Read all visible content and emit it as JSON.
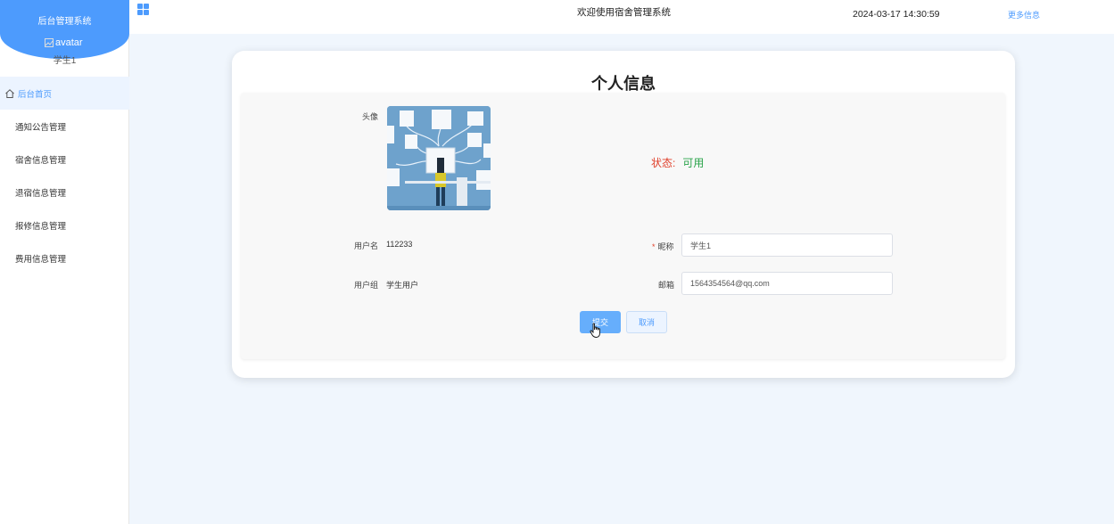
{
  "sidebar": {
    "brand_title": "后台管理系统",
    "avatar_alt": "avatar",
    "user_name": "学生1",
    "items": [
      {
        "label": "后台首页"
      },
      {
        "label": "通知公告管理"
      },
      {
        "label": "宿舍信息管理"
      },
      {
        "label": "退宿信息管理"
      },
      {
        "label": "报修信息管理"
      },
      {
        "label": "费用信息管理"
      }
    ]
  },
  "header": {
    "welcome": "欢迎使用宿舍管理系统",
    "datetime": "2024-03-17 14:30:59",
    "more_info": "更多信息"
  },
  "profile": {
    "title": "个人信息",
    "avatar_label": "头像",
    "status_label": "状态:",
    "status_value": "可用",
    "username_label": "用户名",
    "username_value": "112233",
    "nickname_label": "昵称",
    "nickname_value": "学生1",
    "group_label": "用户组",
    "group_value": "学生用户",
    "email_label": "邮箱",
    "email_value": "1564354564@qq.com",
    "submit_label": "提交",
    "cancel_label": "取消"
  },
  "colors": {
    "primary": "#4d9bfd",
    "status_key": "#e0402b",
    "status_value": "#2aa34a"
  }
}
